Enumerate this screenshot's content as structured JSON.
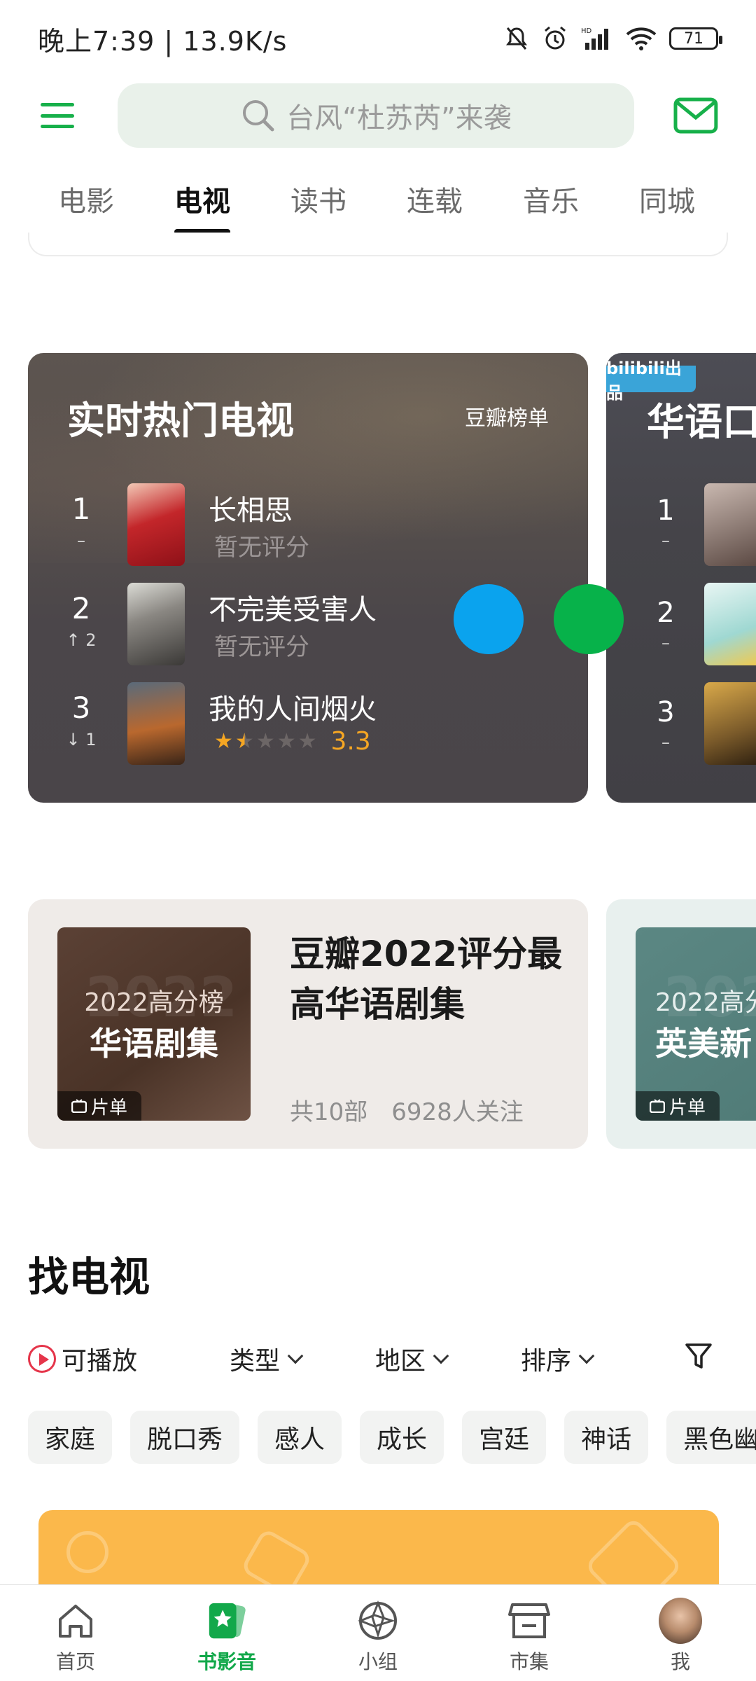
{
  "status_bar": {
    "time": "晚上7:39 | 13.9K/s",
    "battery": "71"
  },
  "header": {
    "search_placeholder": "台风“杜苏芮”来袭"
  },
  "tabs": [
    "电影",
    "电视",
    "读书",
    "连载",
    "音乐",
    "同城"
  ],
  "active_tab": "电视",
  "hot_tv": {
    "title": "实时热门电视",
    "tag": "豆瓣榜单",
    "items": [
      {
        "rank": "1",
        "change": "–",
        "title": "长相思",
        "rating_text": "暂无评分"
      },
      {
        "rank": "2",
        "change": "↑ 2",
        "title": "不完美受害人",
        "rating_text": "暂无评分"
      },
      {
        "rank": "3",
        "change": "↓ 1",
        "title": "我的人间烟火",
        "score": "3.3",
        "stars": 1.5
      }
    ]
  },
  "second_chart": {
    "badge": "bilibili出品",
    "title": "华语口",
    "items": [
      {
        "rank": "1",
        "change": "–"
      },
      {
        "rank": "2",
        "change": "–"
      },
      {
        "rank": "3",
        "change": "–"
      }
    ]
  },
  "playlist": {
    "cover_year": "2022高分榜",
    "cover_name": "华语剧集",
    "badge": "片单",
    "title": "豆瓣2022评分最高华语剧集",
    "count": "共10部",
    "followers": "6928人关注"
  },
  "playlist2": {
    "cover_year": "2022高分",
    "cover_name": "英美新",
    "badge": "片单"
  },
  "find_tv": {
    "title": "找电视",
    "playable": "可播放",
    "filters": [
      "类型",
      "地区",
      "排序"
    ],
    "chips": [
      "家庭",
      "脱口秀",
      "感人",
      "成长",
      "宫廷",
      "神话",
      "黑色幽默"
    ]
  },
  "bottom_nav": [
    "首页",
    "书影音",
    "小组",
    "市集",
    "我"
  ],
  "colors": {
    "accent": "#17b04a",
    "blue_dot": "#0aa3ee",
    "green_dot": "#07b24a",
    "star": "#f5a623"
  }
}
